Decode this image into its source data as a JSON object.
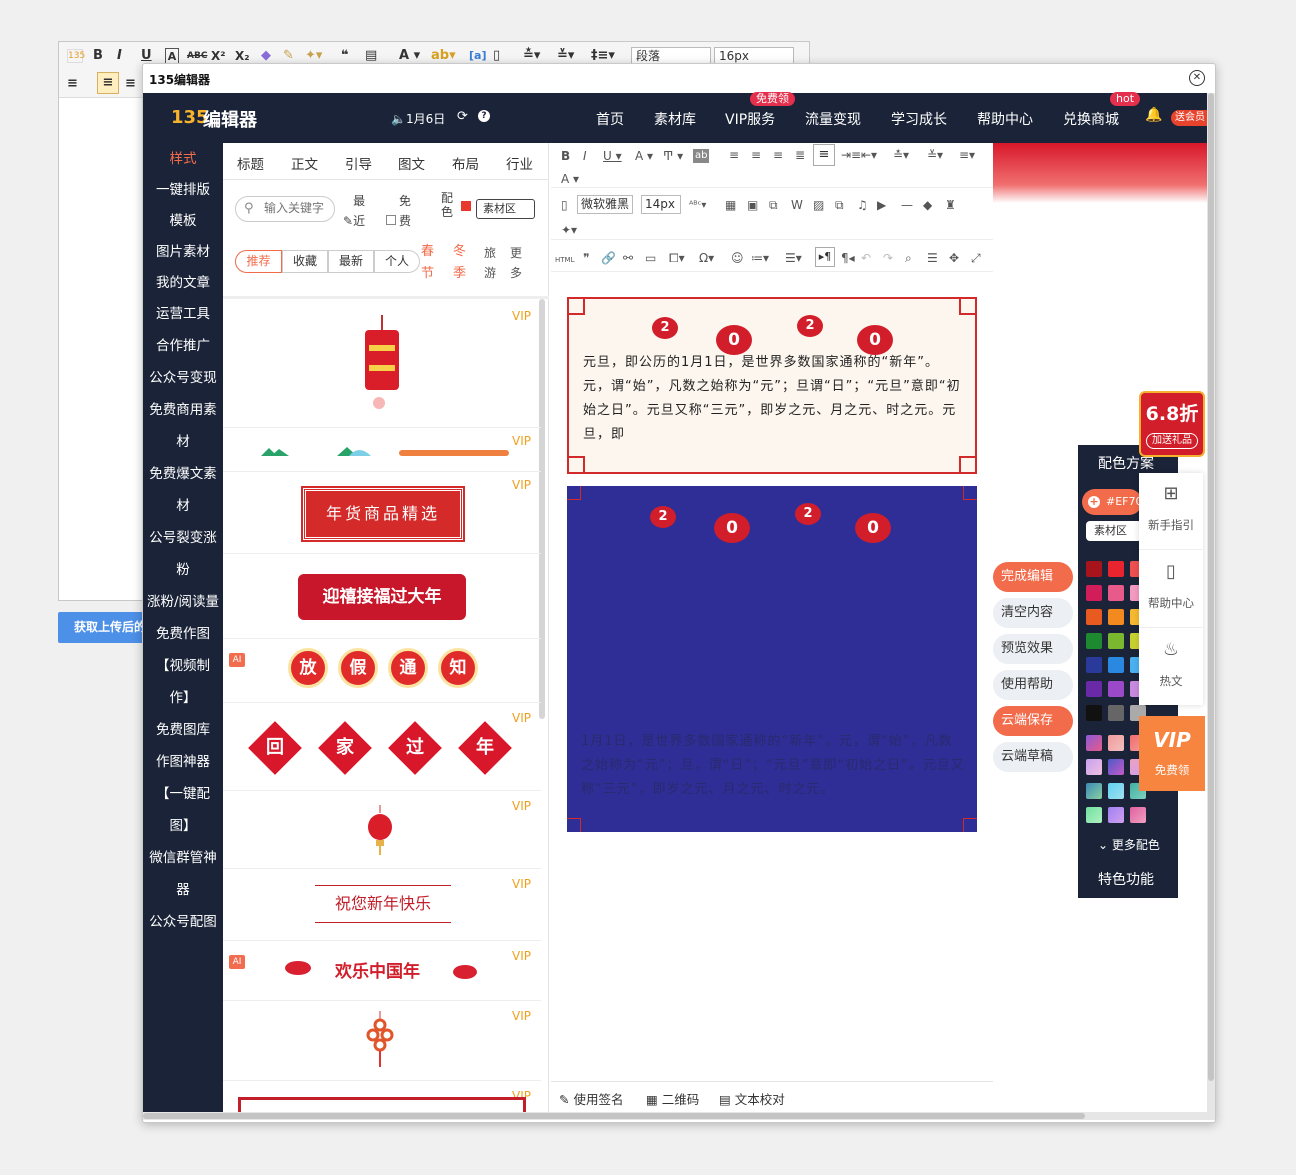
{
  "bg_toolbar": {
    "paragraph_select": "段落",
    "size_select": "16px",
    "btn_bold": "B",
    "btn_italic": "I",
    "btn_underline": "U"
  },
  "get_upload_button": "获取上传后的",
  "dialog": {
    "title": "135编辑器"
  },
  "topnav": {
    "logo_text": "编辑器",
    "date": "🔈1月6日",
    "items": [
      "首页",
      "素材库",
      "VIP服务",
      "流量变现",
      "学习成长",
      "帮助中心",
      "兑换商城"
    ],
    "vip_tag": "免费领",
    "shop_tag": "hot",
    "gift": "送会员"
  },
  "sidenav": [
    "样式",
    "一键排版",
    "模板",
    "图片素材",
    "我的文章",
    "运营工具",
    "合作推广",
    "公众号变现",
    "免费商用素",
    "材",
    "免费爆文素",
    "材",
    "公号裂变涨",
    "粉",
    "涨粉/阅读量",
    "免费作图",
    "【视频制",
    "作】",
    "免费图库",
    "作图神器",
    "【一键配",
    "图】",
    "微信群管神",
    "器",
    "公众号配图"
  ],
  "categories": [
    "标题",
    "正文",
    "引导",
    "图文",
    "布局",
    "行业"
  ],
  "search": {
    "placeholder": "输入关键字"
  },
  "filters": {
    "recent": "最近",
    "free": "免费",
    "color": "配色",
    "material": "素材区"
  },
  "sub_filters": [
    "推荐",
    "收藏",
    "最新",
    "个人"
  ],
  "seasons": {
    "spring": "春节",
    "winter": "冬季",
    "travel": "旅游",
    "more": "更多"
  },
  "tiles": {
    "vip": "VIP",
    "ai": "AI",
    "goods": "年货商品精选",
    "welcome": "迎禧接福过大年",
    "notice": [
      "放",
      "假",
      "通",
      "知"
    ],
    "home": [
      "回",
      "家",
      "过",
      "年"
    ],
    "wish": "祝您新年快乐",
    "joy": "欢乐中国年"
  },
  "editor_toolbar": {
    "font": "微软雅黑",
    "size": "14px",
    "html": "HTML"
  },
  "article": {
    "lantern": [
      "2",
      "0",
      "2",
      "0"
    ],
    "text1": "元旦，即公历的1月1日，是世界多数国家通称的“新年”。元，谓“始”，凡数之始称为“元”；旦谓“日”；“元旦”意即“初始之日”。元旦又称“三元”，即岁之元、月之元、时之元。元旦，即",
    "text2": "1月1日，是世界多数国家通称的“新年”。元，谓“始”，凡数之始称为“元”；旦，谓“日”；“元旦”意即“初始之日”。元旦又称“三元”，即岁之元、月之元、时之元。"
  },
  "footer": {
    "sign": "使用签名",
    "qr": "二维码",
    "proof": "文本校对"
  },
  "actions": [
    "完成编辑",
    "清空内容",
    "预览效果",
    "使用帮助",
    "云端保存",
    "云端草稿"
  ],
  "color_panel": {
    "title": "配色方案",
    "hex": "#EF70",
    "material": "素材区",
    "more": "更多配色",
    "feature": "特色功能"
  },
  "promo": {
    "discount": "6.8折",
    "gift": "加送礼品"
  },
  "features": [
    {
      "label": "新手指引"
    },
    {
      "label": "帮助中心"
    },
    {
      "label": "热文"
    }
  ],
  "vip_free": {
    "title": "VIP",
    "label": "免费领"
  }
}
